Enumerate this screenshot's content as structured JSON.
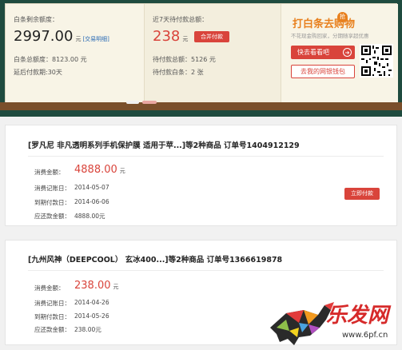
{
  "summary": {
    "remaining_label": "白条剩余额度：",
    "remaining_amount": "2997.00",
    "unit": "元",
    "detail_link": "[交易明细]",
    "total_label": "白条总额度：8123.00 元",
    "delay_label": "延后付款期:30天"
  },
  "pending": {
    "label": "近7天待付款总额：",
    "amount": "238",
    "unit": "元",
    "merge_button": "合并付款",
    "total_label": "待付款总额：5126 元",
    "count_label": "待付款白条：2 张"
  },
  "promo": {
    "title": "打白条去购物",
    "badge": "抢",
    "subtitle": "不花现金购回家，分期随享超优惠",
    "look_button": "快去看看吧",
    "wallet_button": "去我的网银钱包"
  },
  "orders": [
    {
      "title": "[罗凡尼 非凡透明系列手机保护膜 适用于苹...]等2种商品 订单号1404912129",
      "spend_label": "消费金额：",
      "spend_amount": "4888.00",
      "unit": "元",
      "record_label": "消费记账日：",
      "record_date": "2014-05-07",
      "due_label": "到期付款日：",
      "due_date": "2014-06-06",
      "repay_label": "应还款金额：",
      "repay_amount": "4888.00元",
      "pay_button": "立即付款"
    },
    {
      "title": "[九州风神（DEEPCOOL） 玄冰400...]等2种商品 订单号1366619878",
      "spend_label": "消费金额：",
      "spend_amount": "238.00",
      "unit": "元",
      "record_label": "消费记账日：",
      "record_date": "2014-04-26",
      "due_label": "到期付款日：",
      "due_date": "2014-05-26",
      "repay_label": "应还款金额：",
      "repay_amount": "238.00元"
    }
  ],
  "watermark": {
    "brand": "乐发网",
    "url": "www.6pf.cn"
  },
  "colors": {
    "accent_red": "#d9443b",
    "promo_orange": "#e8801e",
    "board_green": "#1f4b3f"
  }
}
